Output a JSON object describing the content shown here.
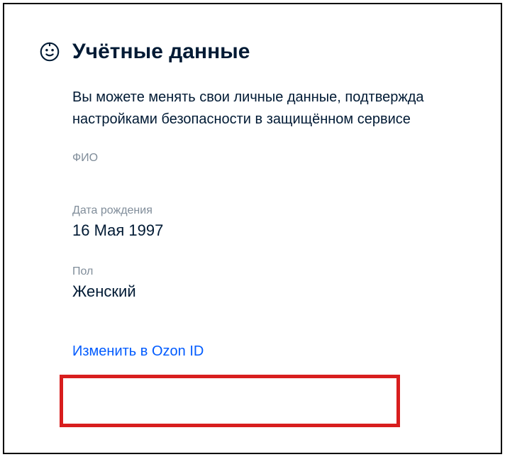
{
  "section": {
    "title": "Учётные данные",
    "description_line1": "Вы можете менять свои личные данные, подтвержда",
    "description_line2": "настройками безопасности в защищённом сервисе"
  },
  "fields": {
    "fio": {
      "label": "ФИО",
      "value": ""
    },
    "dob": {
      "label": "Дата рождения",
      "value": "16 Мая 1997"
    },
    "gender": {
      "label": "Пол",
      "value": "Женский"
    }
  },
  "actions": {
    "change_link": "Изменить в Ozon ID"
  }
}
